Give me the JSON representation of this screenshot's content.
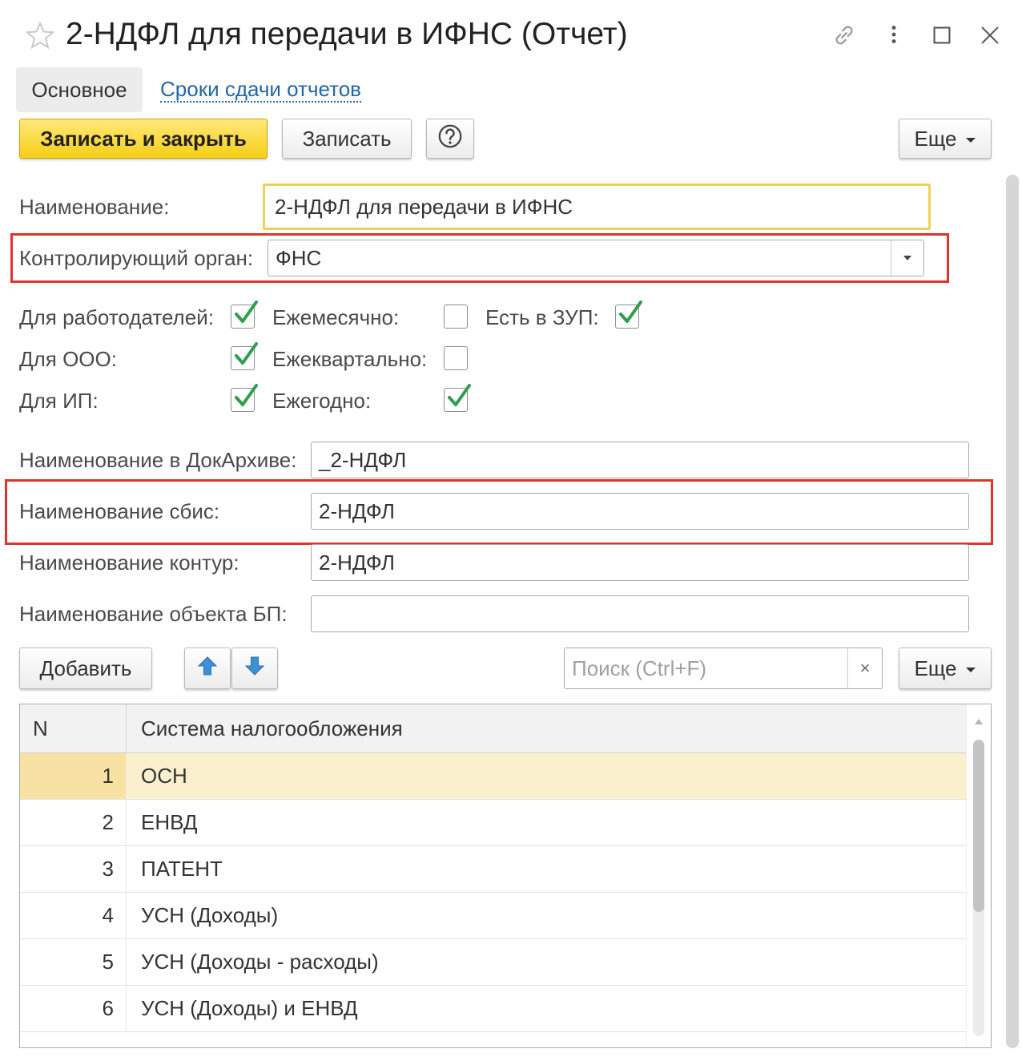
{
  "window": {
    "title": "2-НДФЛ для передачи в ИФНС (Отчет)",
    "icons": [
      "star-icon",
      "link-icon",
      "more-icon",
      "maximize-icon",
      "close-icon"
    ]
  },
  "tabs": {
    "main": "Основное",
    "deadlines": "Сроки сдачи отчетов"
  },
  "toolbar": {
    "save_close": "Записать и закрыть",
    "save": "Записать",
    "help_icon": "question-icon",
    "more": "Еще"
  },
  "form": {
    "name_label": "Наименование:",
    "name_value": "2-НДФЛ для передачи в ИФНС",
    "authority_label": "Контролирующий орган:",
    "authority_value": "ФНС",
    "checkboxes": {
      "employers_label": "Для работодателей:",
      "employers_checked": true,
      "monthly_label": "Ежемесячно:",
      "monthly_checked": false,
      "zup_label": "Есть в ЗУП:",
      "zup_checked": true,
      "ooo_label": "Для ООО:",
      "ooo_checked": true,
      "quarterly_label": "Ежеквартально:",
      "quarterly_checked": false,
      "ip_label": "Для ИП:",
      "ip_checked": true,
      "yearly_label": "Ежегодно:",
      "yearly_checked": true
    },
    "docarchive_label": "Наименование в ДокАрхиве:",
    "docarchive_value": "_2-НДФЛ",
    "sbis_label": "Наименование сбис:",
    "sbis_value": "2-НДФЛ",
    "kontur_label": "Наименование контур:",
    "kontur_value": "2-НДФЛ",
    "bp_label": "Наименование объекта БП:",
    "bp_value": ""
  },
  "table_toolbar": {
    "add": "Добавить",
    "up_icon": "arrow-up-icon",
    "down_icon": "arrow-down-icon",
    "search_placeholder": "Поиск (Ctrl+F)",
    "clear": "×",
    "more": "Еще"
  },
  "table": {
    "col_n": "N",
    "col_system": "Система налогообложения",
    "rows": [
      {
        "n": "1",
        "system": "ОСН"
      },
      {
        "n": "2",
        "system": "ЕНВД"
      },
      {
        "n": "3",
        "system": "ПАТЕНТ"
      },
      {
        "n": "4",
        "system": "УСН (Доходы)"
      },
      {
        "n": "5",
        "system": "УСН (Доходы - расходы)"
      },
      {
        "n": "6",
        "system": "УСН (Доходы) и ЕНВД"
      }
    ],
    "selected_row": 0
  },
  "colors": {
    "accent_yellow": "#f6cf16",
    "link_blue": "#2167a7",
    "highlight_red": "#e0332c",
    "check_green": "#2e9e4f",
    "arrow_blue": "#3d8fd6"
  }
}
